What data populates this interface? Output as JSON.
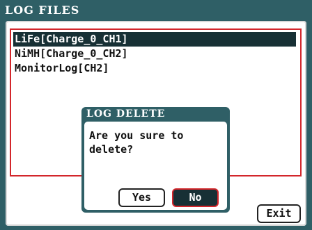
{
  "window": {
    "title": "LOG FILES"
  },
  "log_files": [
    {
      "label": "LiFe[Charge_0_CH1]",
      "selected": true
    },
    {
      "label": "NiMH[Charge_0_CH2]",
      "selected": false
    },
    {
      "label": "MonitorLog[CH2]",
      "selected": false
    }
  ],
  "exit_label": "Exit",
  "dialog": {
    "title": "LOG DELETE",
    "message": "Are you sure to delete?",
    "yes_label": "Yes",
    "no_label": "No",
    "focused_button": "No"
  },
  "colors": {
    "frame": "#2f5f66",
    "selection": "#173035",
    "list_border": "#d3262b",
    "focus_border": "#d3262b"
  }
}
